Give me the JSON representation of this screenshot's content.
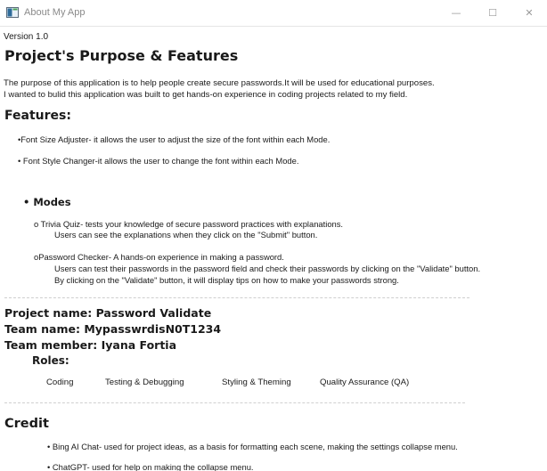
{
  "window": {
    "title": "About My App",
    "minimize_glyph": "—",
    "maximize_glyph": "☐",
    "close_glyph": "✕"
  },
  "version": "Version 1.0",
  "purpose": {
    "heading": "Project's Purpose & Features",
    "line1": "The purpose of this application is to help people create secure passwords.It will be used for educational purposes.",
    "line2": "I wanted to bulid this application was built to get hands-on experience in coding projects related to my field."
  },
  "features": {
    "heading": "Features:",
    "item1": "•Font Size Adjuster- it allows the user to adjust the size of the font within each Mode.",
    "item2": "• Font Style Changer-it allows the user to change the font within each Mode.",
    "modes_heading": "• Modes",
    "trivia_line1": "o Trivia Quiz- tests your knowledge of secure password practices with explanations.",
    "trivia_line2": "Users can see the explanations when they click on the \"Submit\" button.",
    "checker_line1": "oPassword Checker- A hands-on experience in making a password.",
    "checker_line2": "Users can test their passwords in the password field and check their passwords by clicking on the \"Validate\" button.",
    "checker_line3": "By clicking on the \"Validate\" button, it will display tips on how to make your passwords strong."
  },
  "project": {
    "name": "Project name: Password Validate",
    "team": "Team name: MypasswrdisN0T1234",
    "member": "Team member: Iyana Fortia",
    "roles_heading": "Roles:",
    "roles": [
      "Coding",
      "Testing & Debugging",
      "Styling & Theming",
      "Quality Assurance (QA)"
    ]
  },
  "credit": {
    "heading": "Credit",
    "item1": "• Bing AI Chat- used for project ideas, as a basis for formatting each scene, making the settings collapse menu.",
    "item2": "• ChatGPT- used for help on making the collapse menu."
  }
}
